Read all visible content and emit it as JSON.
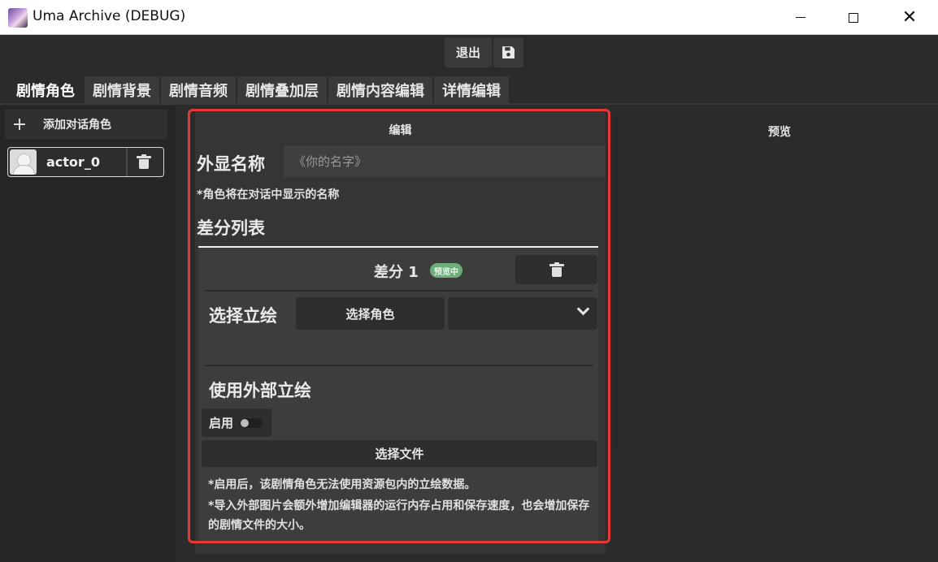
{
  "window": {
    "title": "Uma Archive (DEBUG)",
    "minimize_icon": "minimize-icon",
    "maximize_icon": "maximize-icon",
    "close_icon": "close-icon",
    "close_glyph": "✕"
  },
  "toolbar": {
    "exit_label": "退出",
    "save_icon": "floppy-disk-icon"
  },
  "tabs": [
    {
      "label": "剧情角色",
      "active": true
    },
    {
      "label": "剧情背景",
      "active": false
    },
    {
      "label": "剧情音频",
      "active": false
    },
    {
      "label": "剧情叠加层",
      "active": false
    },
    {
      "label": "剧情内容编辑",
      "active": false
    },
    {
      "label": "详情编辑",
      "active": false
    }
  ],
  "sidebar": {
    "add_label": "添加对话角色",
    "add_glyph": "+",
    "actors": [
      {
        "name": "actor_0",
        "avatar_icon": "avatar-placeholder-icon",
        "delete_icon": "trash-icon"
      }
    ]
  },
  "editor": {
    "header": "编辑",
    "display_name_label": "外显名称",
    "display_name_placeholder": "《你的名字》",
    "display_name_value": "",
    "display_name_note": "*角色将在对话中显示的名称",
    "diff_list_label": "差分列表",
    "diff": {
      "title": "差分 1",
      "badge": "预览中",
      "badge_color": "#6fae7a",
      "select_art_label": "选择立绘",
      "select_role_button": "选择角色",
      "dropdown_value": "",
      "external_art_label": "使用外部立绘",
      "enable_label": "启用",
      "enable_on": false,
      "select_file_button": "选择文件",
      "note_1": "*启用后，该剧情角色无法使用资源包内的立绘数据。",
      "note_2": "*导入外部图片会额外增加编辑器的运行内存占用和保存速度，也会增加保存的剧情文件的大小。"
    }
  },
  "preview": {
    "title": "预览"
  },
  "colors": {
    "highlight": "#e53935",
    "background": "#2b2b2b",
    "panel": "#353535"
  }
}
